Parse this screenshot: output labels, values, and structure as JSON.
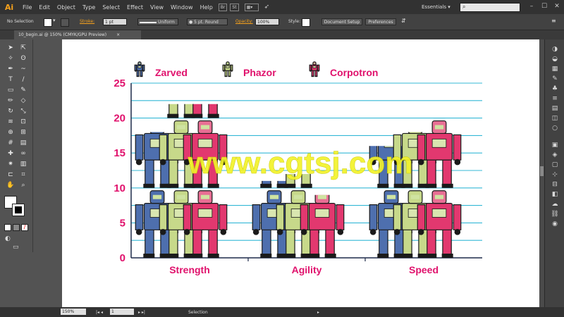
{
  "app": {
    "logo": "Ai",
    "menu": [
      "File",
      "Edit",
      "Object",
      "Type",
      "Select",
      "Effect",
      "View",
      "Window",
      "Help"
    ],
    "bridge": "Br",
    "stock": "St",
    "workspace": "Essentials",
    "search_placeholder": ""
  },
  "control_bar": {
    "selection": "No Selection",
    "stroke_label": "Stroke:",
    "stroke_weight": "1 pt",
    "stroke_profile": "Uniform",
    "brush": "5 pt. Round",
    "opacity_label": "Opacity:",
    "opacity_value": "100%",
    "style_label": "Style:",
    "doc_setup": "Document Setup",
    "preferences": "Preferences"
  },
  "document": {
    "tab_title": "10_begin.ai @ 150% (CMYK/GPU Preview)",
    "close_glyph": "×"
  },
  "status": {
    "zoom": "150%",
    "artboard_number": "1",
    "tool_status": "Selection"
  },
  "tools": [
    "selection-tool-icon",
    "direct-selection-tool-icon",
    "magic-wand-icon",
    "lasso-icon",
    "pen-tool-icon",
    "curvature-tool-icon",
    "type-tool-icon",
    "line-segment-icon",
    "rectangle-tool-icon",
    "paintbrush-icon",
    "pencil-icon",
    "eraser-icon",
    "rotate-tool-icon",
    "scale-tool-icon",
    "width-tool-icon",
    "free-transform-icon",
    "shape-builder-icon",
    "perspective-grid-icon",
    "mesh-tool-icon",
    "gradient-tool-icon",
    "eyedropper-icon",
    "blend-tool-icon",
    "symbol-sprayer-icon",
    "column-graph-tool-icon",
    "artboard-tool-icon",
    "slice-tool-icon",
    "hand-tool-icon",
    "zoom-tool-icon"
  ],
  "chart_data": {
    "type": "bar",
    "categories": [
      "Strength",
      "Agility",
      "Speed"
    ],
    "series": [
      {
        "name": "Zarved",
        "values": [
          18,
          11,
          16
        ]
      },
      {
        "name": "Phazor",
        "values": [
          22,
          12,
          18
        ]
      },
      {
        "name": "Corpotron",
        "values": [
          22,
          9,
          20
        ]
      }
    ],
    "ylim": [
      0,
      25
    ],
    "yticks": [
      "0",
      "5",
      "10",
      "15",
      "20",
      "25"
    ],
    "grid": true,
    "legend": "top-left",
    "colors": {
      "Zarved": "#4e6fae",
      "Phazor": "#c7d98a",
      "Corpotron": "#e2386f",
      "grid": "#34b8d6",
      "text": "#e0116c"
    }
  },
  "watermark": "www.cgtsj.com"
}
